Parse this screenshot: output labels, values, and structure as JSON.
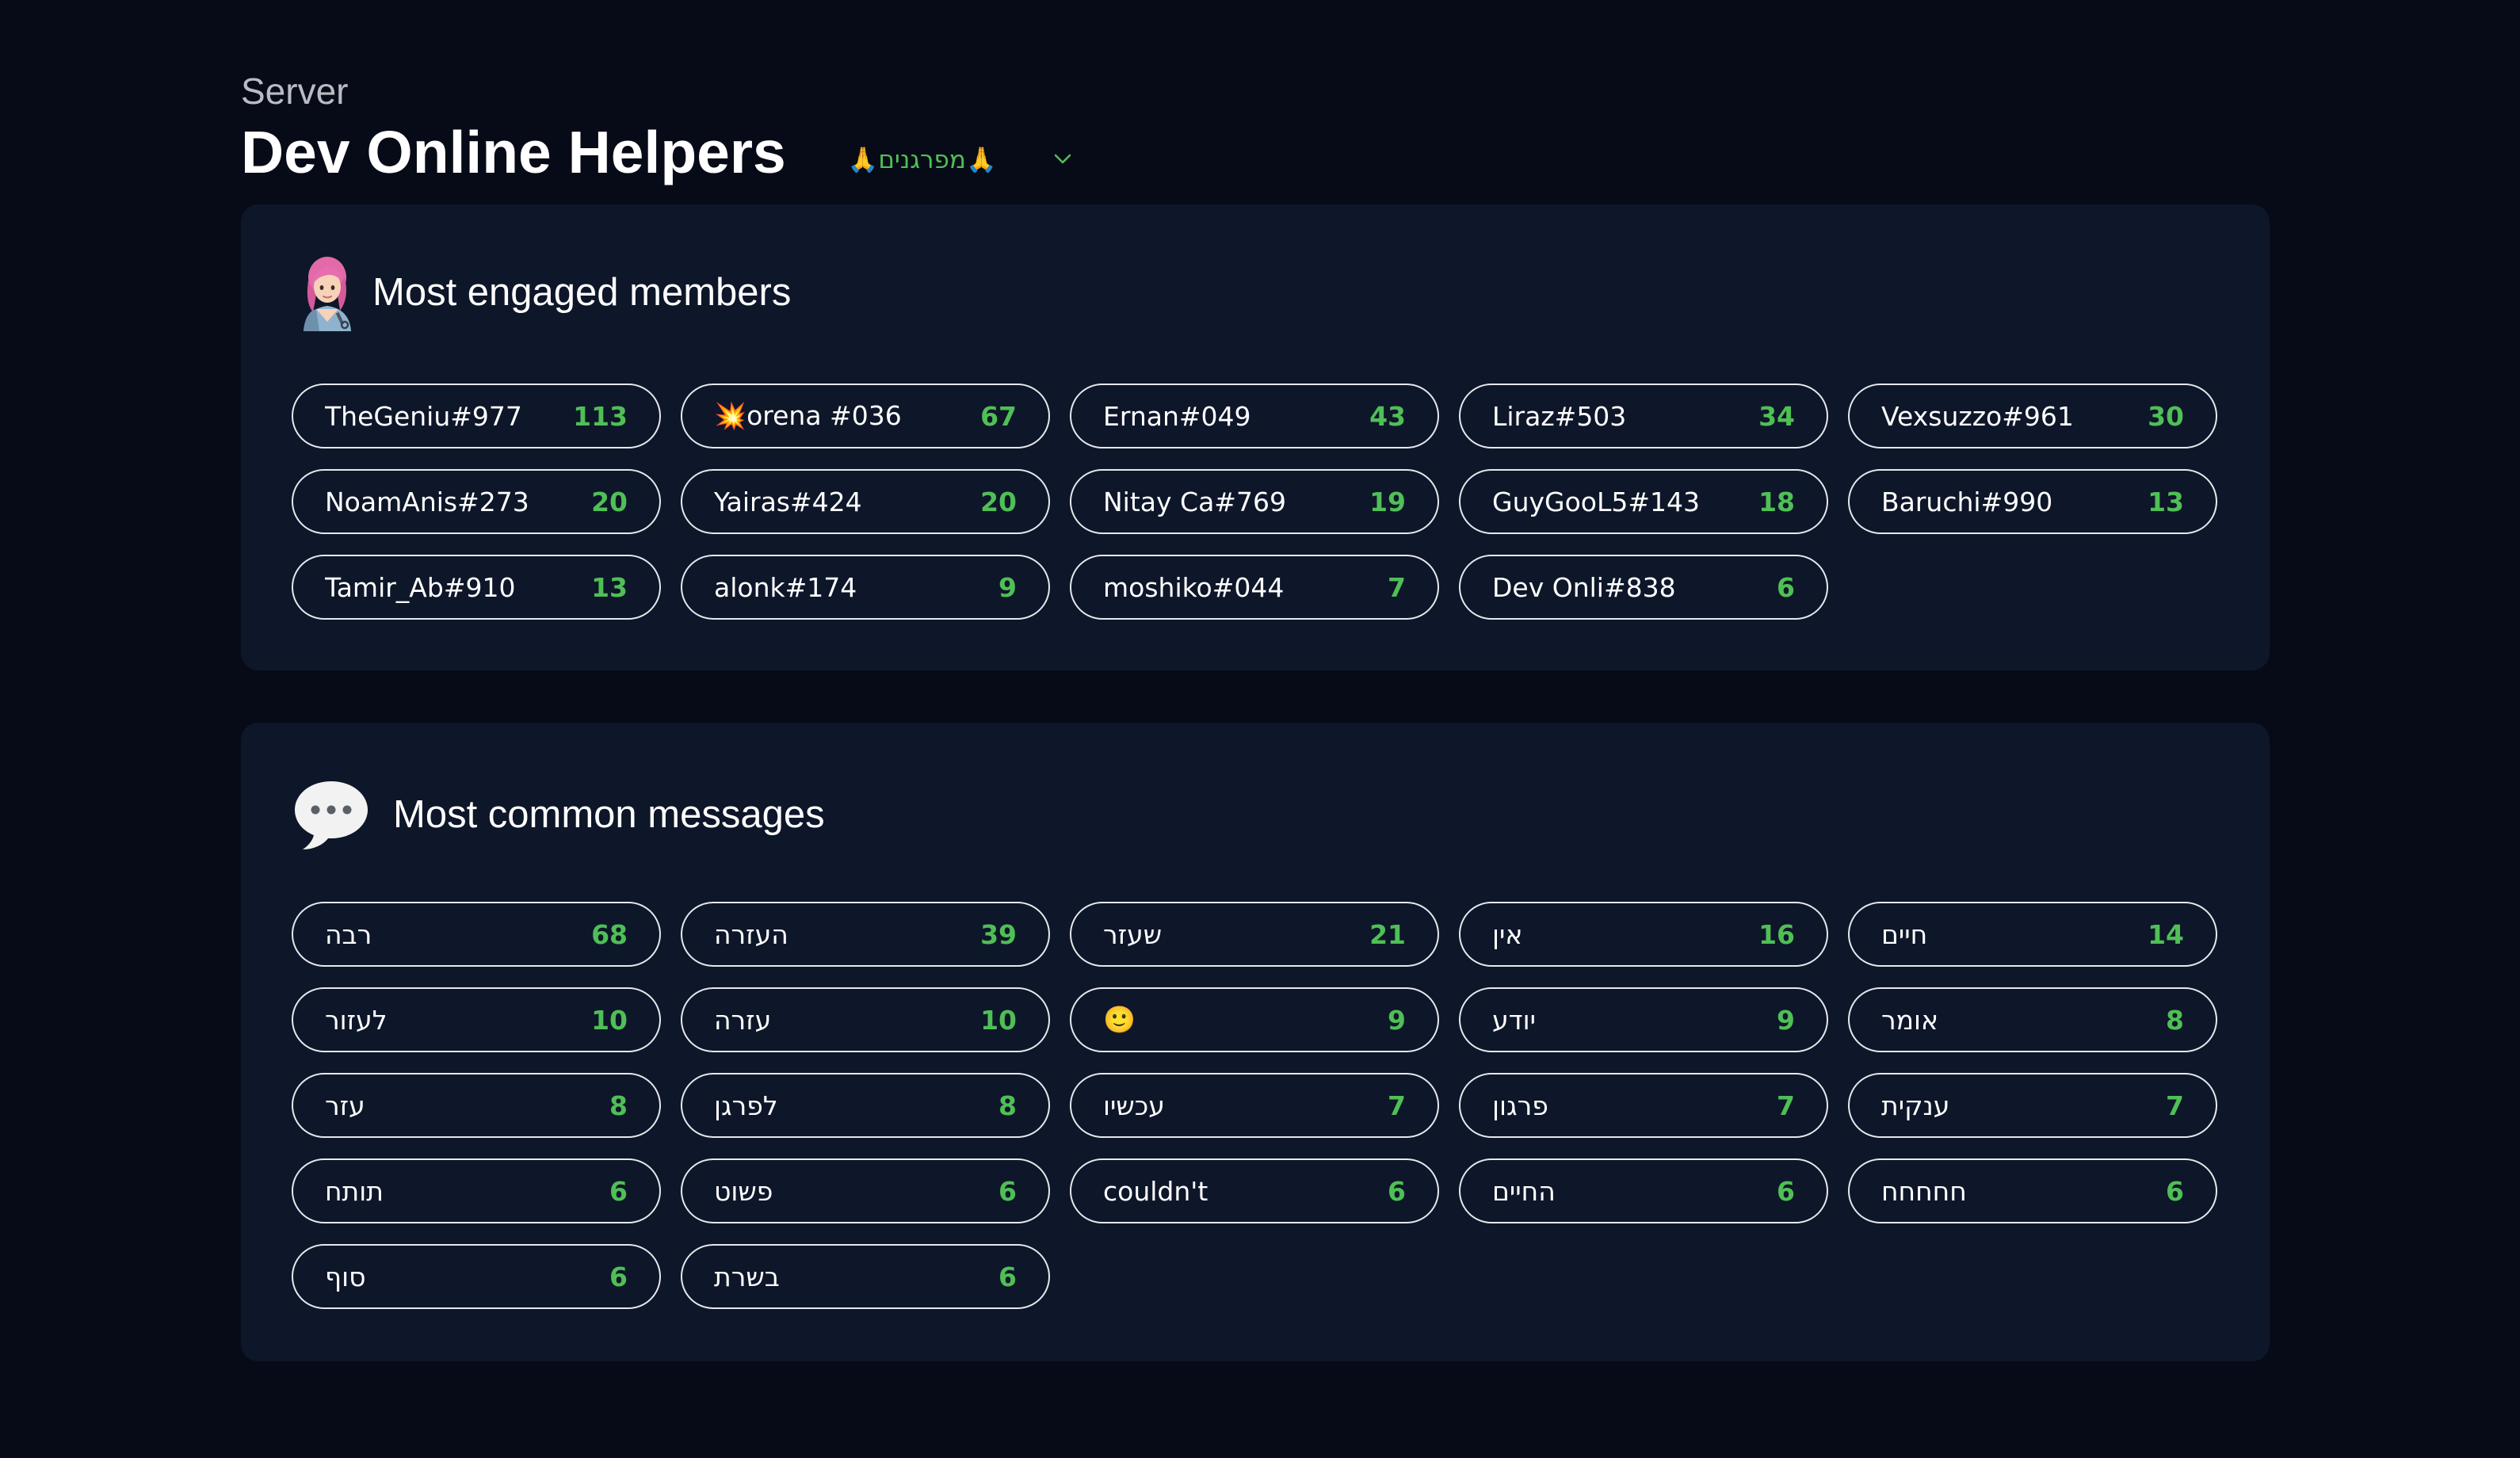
{
  "header": {
    "kicker": "Server",
    "server_name": "Dev Online Helpers",
    "selector_value": "🙏מפרגנים🙏",
    "selector_icon": "chevron-down-icon"
  },
  "colors": {
    "background": "#070b17",
    "panel": "#0e1629",
    "accent_green": "#4fbf56",
    "pill_border": "#e6e8ec"
  },
  "engaged": {
    "title": "Most engaged members",
    "icon": "woman-hairdresser-emoji-icon",
    "members": [
      {
        "name": "TheGeniu#977",
        "count": "113"
      },
      {
        "name": "💥orena #036",
        "count": "67"
      },
      {
        "name": "Ernan#049",
        "count": "43"
      },
      {
        "name": "Liraz#503",
        "count": "34"
      },
      {
        "name": "Vexsuzzo#961",
        "count": "30"
      },
      {
        "name": "NoamAnis#273",
        "count": "20"
      },
      {
        "name": "Yairas#424",
        "count": "20"
      },
      {
        "name": "Nitay Ca#769",
        "count": "19"
      },
      {
        "name": "GuyGooL5#143",
        "count": "18"
      },
      {
        "name": "Baruchi#990",
        "count": "13"
      },
      {
        "name": "Tamir_Ab#910",
        "count": "13"
      },
      {
        "name": "alonk#174",
        "count": "9"
      },
      {
        "name": "moshiko#044",
        "count": "7"
      },
      {
        "name": "Dev Onli#838",
        "count": "6"
      }
    ]
  },
  "messages": {
    "title": "Most common messages",
    "icon": "speech-bubble-icon",
    "items": [
      {
        "text": "רבה",
        "count": "68"
      },
      {
        "text": "העזרה",
        "count": "39"
      },
      {
        "text": "שעזר",
        "count": "21"
      },
      {
        "text": "אין",
        "count": "16"
      },
      {
        "text": "חיים",
        "count": "14"
      },
      {
        "text": "לעזור",
        "count": "10"
      },
      {
        "text": "עזרה",
        "count": "10"
      },
      {
        "text": "🙂",
        "count": "9"
      },
      {
        "text": "יודע",
        "count": "9"
      },
      {
        "text": "אומר",
        "count": "8"
      },
      {
        "text": "עזר",
        "count": "8"
      },
      {
        "text": "לפרגן",
        "count": "8"
      },
      {
        "text": "עכשיו",
        "count": "7"
      },
      {
        "text": "פרגון",
        "count": "7"
      },
      {
        "text": "ענקית",
        "count": "7"
      },
      {
        "text": "תותח",
        "count": "6"
      },
      {
        "text": "פשוט",
        "count": "6"
      },
      {
        "text": "couldn't",
        "count": "6"
      },
      {
        "text": "החיים",
        "count": "6"
      },
      {
        "text": "חחחחח",
        "count": "6"
      },
      {
        "text": "סוף",
        "count": "6"
      },
      {
        "text": "בשרת",
        "count": "6"
      }
    ]
  }
}
